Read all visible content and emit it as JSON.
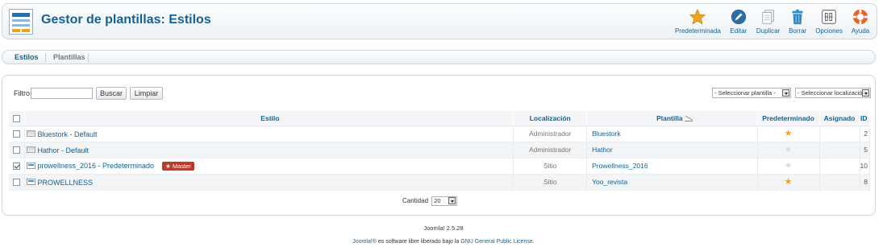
{
  "header": {
    "title": "Gestor de plantillas: Estilos",
    "logo_icon": "template-manager-icon"
  },
  "toolbar": [
    {
      "label": "Predeterminada",
      "icon": "star-icon",
      "color": "#f0a31e"
    },
    {
      "label": "Editar",
      "icon": "edit-icon",
      "color": "#2e6da4"
    },
    {
      "label": "Duplicar",
      "icon": "duplicate-icon",
      "color": "#9aa9b8"
    },
    {
      "label": "Borrar",
      "icon": "trash-icon",
      "color": "#2e89c4"
    },
    {
      "label": "Opciones",
      "icon": "options-icon",
      "color": "#555555"
    },
    {
      "label": "Ayuda",
      "icon": "help-icon",
      "color": "#e8622a"
    }
  ],
  "submenu": {
    "tabs": [
      "Estilos",
      "Plantillas"
    ]
  },
  "filter": {
    "label": "Filtro:",
    "value": "",
    "search_label": "Buscar",
    "clear_label": "Limpiar",
    "template_select": "- Seleccionar plantilla -",
    "location_select": "- Seleccionar localización -"
  },
  "table": {
    "columns": [
      "Estilo",
      "Localización",
      "Plantilla",
      "Predeterminado",
      "Asignado",
      "ID"
    ],
    "rows": [
      {
        "style": "Bluestork - Default",
        "location": "Administrador",
        "template": "Bluestork",
        "default": true,
        "id": "2",
        "checked": false,
        "badge": ""
      },
      {
        "style": "Hathor - Default",
        "location": "Administrador",
        "template": "Hathor",
        "default": false,
        "id": "5",
        "checked": false,
        "badge": ""
      },
      {
        "style": "prowellness_2016 - Predeterminado",
        "location": "Sitio",
        "template": "Prowellness_2016",
        "default": false,
        "id": "10",
        "checked": true,
        "badge": "★ Master"
      },
      {
        "style": "PROWELLNESS",
        "location": "Sitio",
        "template": "Yoo_revista",
        "default": true,
        "id": "8",
        "checked": false,
        "badge": ""
      }
    ]
  },
  "pagination": {
    "label": "Cantidad",
    "value": "20"
  },
  "footer": {
    "version": "Joomla! 2.5.28",
    "license_brand": "Joomla!®",
    "license_text": " es software libre liberado bajo la ",
    "license_link": "GNU General Public License."
  },
  "colors": {
    "accent": "#146295",
    "badge": "#c0392b",
    "star": "#f0a31e"
  }
}
